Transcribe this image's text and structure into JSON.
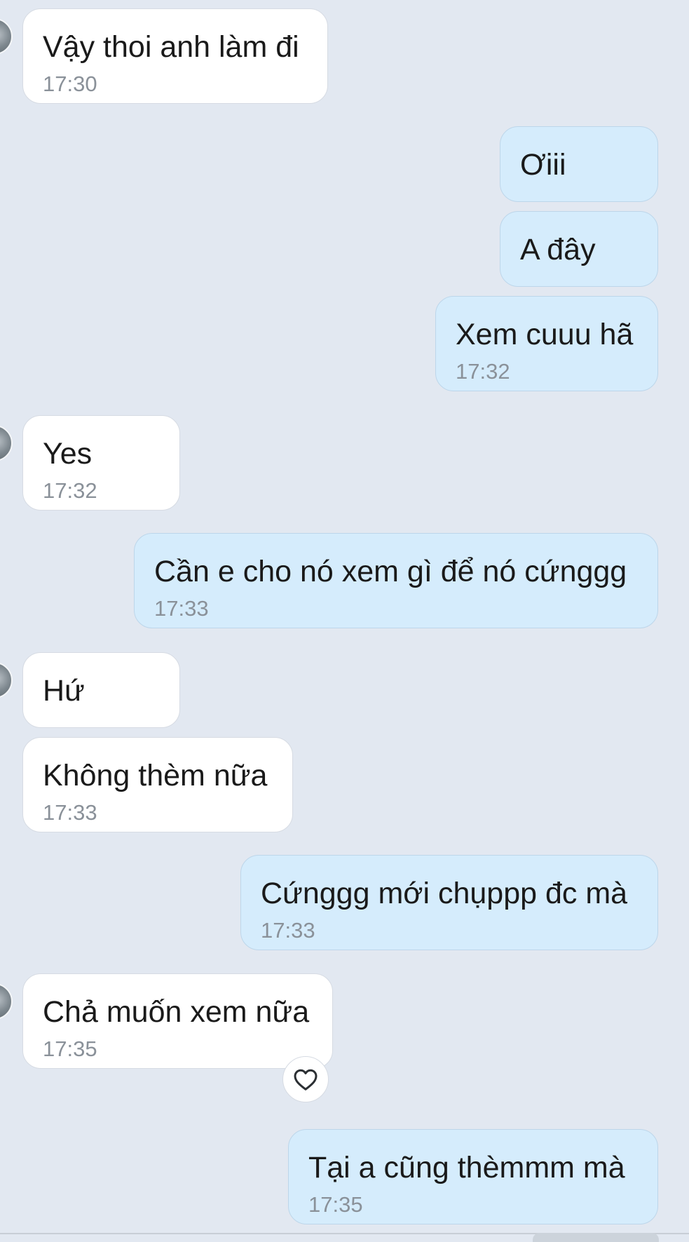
{
  "messages": [
    {
      "text": "Vậy thoi anh làm đi",
      "time": "17:30"
    },
    {
      "text": "Ơiii",
      "time": ""
    },
    {
      "text": "A đây",
      "time": ""
    },
    {
      "text": "Xem cuuu hã",
      "time": "17:32"
    },
    {
      "text": "Yes",
      "time": "17:32"
    },
    {
      "text": "Cần e cho nó xem gì để nó cứnggg",
      "time": "17:33"
    },
    {
      "text": "Hứ",
      "time": ""
    },
    {
      "text": "Không thèm nữa",
      "time": "17:33"
    },
    {
      "text": "Cứnggg mới chụppp đc mà",
      "time": "17:33"
    },
    {
      "text": "Chả muốn xem nữa",
      "time": "17:35"
    },
    {
      "text": "Tại a cũng thèmmm mà",
      "time": "17:35"
    }
  ],
  "reaction_icon": "heart-outline-icon",
  "colors": {
    "background": "#e2e8f1",
    "incoming_bubble": "#ffffff",
    "outgoing_bubble": "#d5ecfc",
    "timestamp": "#8a9199"
  }
}
